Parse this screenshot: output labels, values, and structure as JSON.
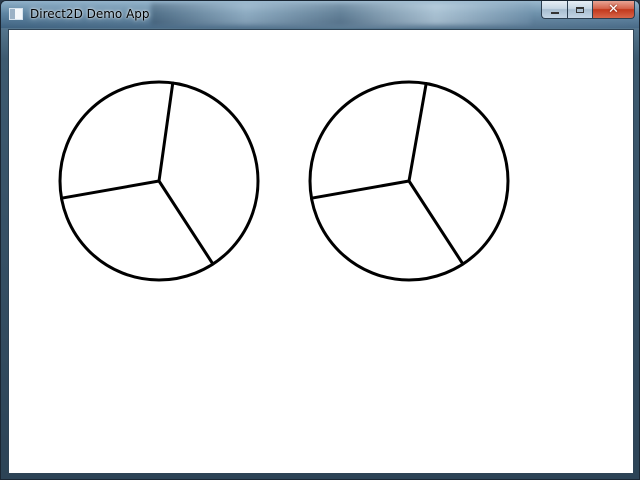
{
  "window": {
    "title": "Direct2D Demo App",
    "app_icon": "window-app-icon",
    "caption_buttons": {
      "minimize_icon": "minimize-icon",
      "maximize_icon": "maximize-icon",
      "close_glyph": "✕"
    }
  },
  "canvas": {
    "background": "#ffffff",
    "stroke_color": "#000000",
    "pies": [
      {
        "name": "pie-left",
        "slices": 3,
        "spoke_angles_deg": [
          -82,
          170,
          57
        ]
      },
      {
        "name": "pie-right",
        "slices": 3,
        "spoke_angles_deg": [
          -80,
          170,
          57
        ]
      }
    ]
  }
}
